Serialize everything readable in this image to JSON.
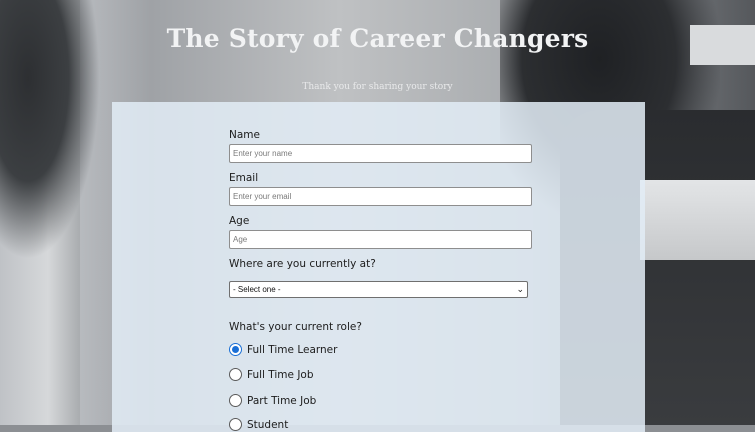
{
  "page": {
    "title": "The Story of Career Changers",
    "subtitle": "Thank you for sharing your story"
  },
  "form": {
    "name": {
      "label": "Name",
      "placeholder": "Enter your name"
    },
    "email": {
      "label": "Email",
      "placeholder": "Enter your email"
    },
    "age": {
      "label": "Age",
      "placeholder": "Age"
    },
    "location": {
      "label": "Where are you currently at?",
      "selected": "- Select one -"
    },
    "role": {
      "label": "What's your current role?",
      "options": [
        "Full Time Learner",
        "Full Time Job",
        "Part Time Job",
        "Student"
      ],
      "selected": "Full Time Learner"
    }
  }
}
